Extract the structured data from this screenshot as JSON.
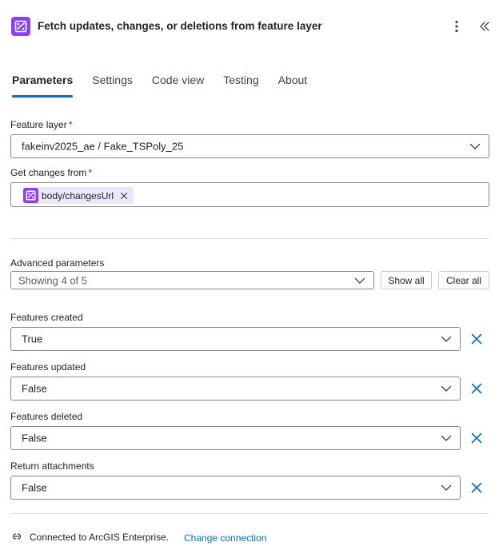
{
  "header": {
    "title": "Fetch updates, changes, or deletions from feature layer",
    "icons": [
      "arcgis-logo-icon",
      "more-options-icon",
      "collapse-panel-icon"
    ]
  },
  "tabs": [
    {
      "label": "Parameters",
      "active": true
    },
    {
      "label": "Settings",
      "active": false
    },
    {
      "label": "Code view",
      "active": false
    },
    {
      "label": "Testing",
      "active": false
    },
    {
      "label": "About",
      "active": false
    }
  ],
  "feature_layer": {
    "label": "Feature layer",
    "required_mark": "*",
    "value": "fakeinv2025_ae / Fake_TSPoly_25"
  },
  "get_changes_from": {
    "label": "Get changes from",
    "required_mark": "*",
    "token": "body/changesUrl"
  },
  "advanced": {
    "label": "Advanced parameters",
    "value": "Showing 4 of 5",
    "show_all": "Show all",
    "clear_all": "Clear all"
  },
  "params": [
    {
      "label": "Features created",
      "value": "True"
    },
    {
      "label": "Features updated",
      "value": "False"
    },
    {
      "label": "Features deleted",
      "value": "False"
    },
    {
      "label": "Return attachments",
      "value": "False"
    }
  ],
  "footer": {
    "status": "Connected to ArcGIS Enterprise.",
    "link": "Change connection"
  },
  "colors": {
    "accent": "#0f6cbd",
    "brand_purple": "#8a3ffc",
    "token_bg": "#ede6fb",
    "required": "#c50f1f"
  }
}
